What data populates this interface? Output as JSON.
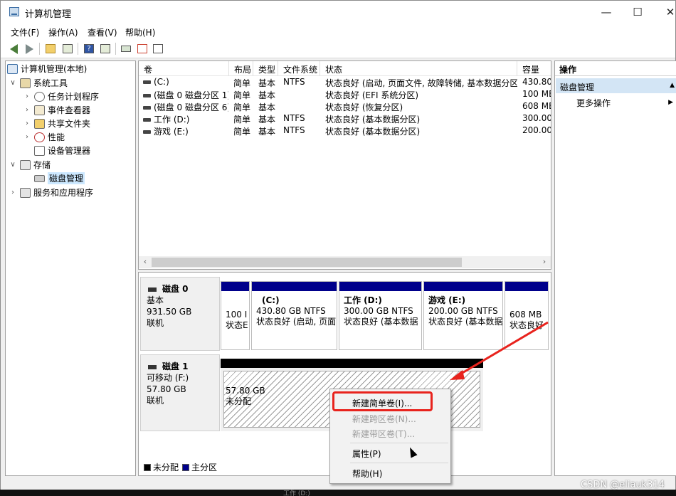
{
  "window": {
    "title": "计算机管理",
    "minimize": "—",
    "maximize": "☐",
    "close": "✕"
  },
  "menu": [
    "文件(F)",
    "操作(A)",
    "查看(V)",
    "帮助(H)"
  ],
  "toolbar_icons": [
    "back-arrow-icon",
    "forward-arrow-icon",
    "folder-up-icon",
    "show-hide-tree-icon",
    "help-icon",
    "show-hide-action-pane-icon",
    "connect-icon",
    "checklist-icon",
    "properties-icon"
  ],
  "tree": {
    "root": "计算机管理(本地)",
    "system_tools": "系统工具",
    "task_scheduler": "任务计划程序",
    "event_viewer": "事件查看器",
    "shared_folders": "共享文件夹",
    "performance": "性能",
    "device_manager": "设备管理器",
    "storage": "存储",
    "disk_management": "磁盘管理",
    "services_apps": "服务和应用程序"
  },
  "volume_table": {
    "columns": [
      "卷",
      "布局",
      "类型",
      "文件系统",
      "状态",
      "容量"
    ],
    "rows": [
      [
        "(C:)",
        "简单",
        "基本",
        "NTFS",
        "状态良好 (启动, 页面文件, 故障转储, 基本数据分区)",
        "430.80"
      ],
      [
        "(磁盘 0 磁盘分区 1)",
        "简单",
        "基本",
        "",
        "状态良好 (EFI 系统分区)",
        "100 ME"
      ],
      [
        "(磁盘 0 磁盘分区 6)",
        "简单",
        "基本",
        "",
        "状态良好 (恢复分区)",
        "608 ME"
      ],
      [
        "工作 (D:)",
        "简单",
        "基本",
        "NTFS",
        "状态良好 (基本数据分区)",
        "300.00"
      ],
      [
        "游戏 (E:)",
        "简单",
        "基本",
        "NTFS",
        "状态良好 (基本数据分区)",
        "200.00"
      ]
    ]
  },
  "disk0": {
    "name": "磁盘 0",
    "type": "基本",
    "size": "931.50 GB",
    "status": "联机",
    "partitions": [
      {
        "title": "",
        "size": "100 I",
        "state": "状态E"
      },
      {
        "title": "(C:)",
        "size": "430.80 GB NTFS",
        "state": "状态良好 (启动, 页面"
      },
      {
        "title": "工作  (D:)",
        "size": "300.00 GB NTFS",
        "state": "状态良好 (基本数据"
      },
      {
        "title": "游戏  (E:)",
        "size": "200.00 GB NTFS",
        "state": "状态良好 (基本数据"
      },
      {
        "title": "",
        "size": "608 MB",
        "state": "状态良好"
      }
    ]
  },
  "disk1": {
    "name": "磁盘 1",
    "type": "可移动 (F:)",
    "size": "57.80 GB",
    "status": "联机",
    "partition": {
      "size": "57.80 GB",
      "state": "未分配"
    }
  },
  "legend": {
    "unallocated": "未分配",
    "primary": "主分区",
    "unallocated_color": "#000000",
    "primary_color": "#00008b"
  },
  "actions": {
    "header": "操作",
    "section": "磁盘管理",
    "more": "更多操作"
  },
  "context_menu": {
    "new_simple": "新建简单卷(I)...",
    "new_spanned": "新建跨区卷(N)...",
    "new_striped": "新建带区卷(T)...",
    "properties": "属性(P)",
    "help": "帮助(H)"
  },
  "taskbar_text": "工作 (D:)",
  "watermark": "CSDN @eliauk314",
  "accent_color": "#e8231d"
}
